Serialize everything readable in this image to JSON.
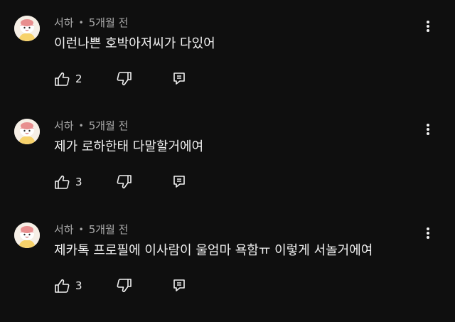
{
  "comments": [
    {
      "author": "서하",
      "separator": "•",
      "time": "5개월 전",
      "text": "이런나쁜 호박아저씨가 다있어",
      "likes": "2"
    },
    {
      "author": "서하",
      "separator": "•",
      "time": "5개월 전",
      "text": "제가 로하한태 다말할거에여",
      "likes": "3"
    },
    {
      "author": "서하",
      "separator": "•",
      "time": "5개월 전",
      "text": "제카톡 프로필에 이사람이 울엄마 욕함ㅠ 이렇게 서놀거에여",
      "likes": "3"
    }
  ],
  "icons": {
    "avatar": "avatar-character",
    "more": "kebab-menu-icon",
    "like": "thumbs-up-icon",
    "dislike": "thumbs-down-icon",
    "reply": "reply-comment-icon"
  },
  "colors": {
    "background": "#0f0f0f",
    "primary_text": "#f1f1f1",
    "secondary_text": "#aaaaaa"
  }
}
